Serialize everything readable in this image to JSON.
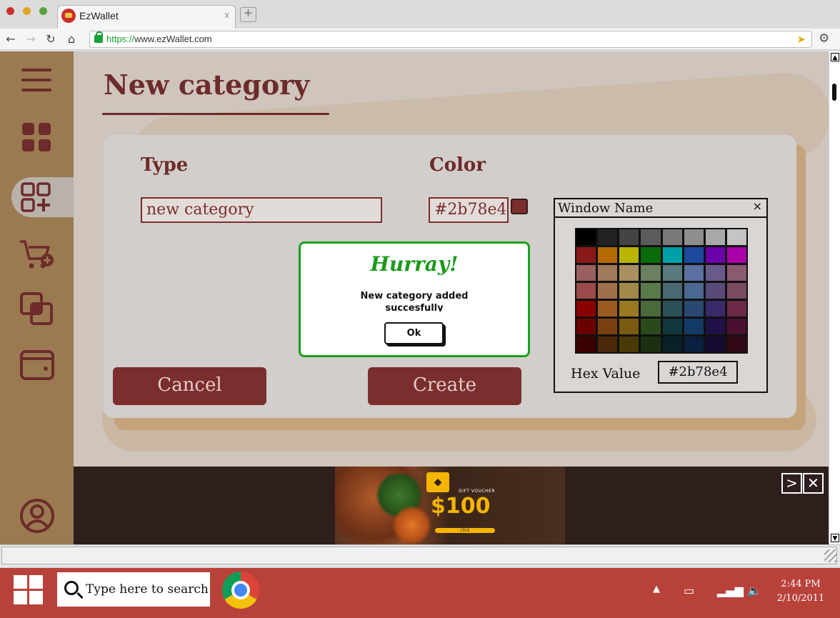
{
  "browser": {
    "tab_title": "EzWallet",
    "tab_close": "x",
    "url_scheme": "https://",
    "url_rest": "www.ezWallet.com"
  },
  "page": {
    "title": "New category",
    "type_label": "Type",
    "type_value": "new category",
    "color_label": "Color",
    "color_value": "#2b78e4",
    "cancel_label": "Cancel",
    "create_label": "Create"
  },
  "color_picker": {
    "window_name": "Window Name",
    "close": "×",
    "hex_label": "Hex Value",
    "hex_value": "#2b78e4",
    "palette": [
      "#000000",
      "#222222",
      "#444444",
      "#5b5b5b",
      "#7a7a7a",
      "#8e8e8e",
      "#a8a8a8",
      "#c4c4c4",
      "#8a1a1a",
      "#b46a00",
      "#b8b400",
      "#0a6b0a",
      "#00a0a8",
      "#1d4a9e",
      "#6b00a8",
      "#a800a8",
      "#9a6060",
      "#a07a5a",
      "#a89060",
      "#6a8060",
      "#5a7a80",
      "#5a70a0",
      "#6a5a8a",
      "#8a5a70",
      "#9a4a4a",
      "#a0704a",
      "#a08a4a",
      "#5a7a4a",
      "#4a6870",
      "#4a6890",
      "#5a4a7a",
      "#7a4a60",
      "#8a0000",
      "#9a5a20",
      "#9a7a20",
      "#4a6a3a",
      "#2a5058",
      "#2a4870",
      "#3a2a6a",
      "#6a2a48",
      "#6a0000",
      "#7a4010",
      "#7a5a10",
      "#2a4a1a",
      "#10363e",
      "#123a64",
      "#221048",
      "#4a1030",
      "#3a0000",
      "#4a2808",
      "#4a3a08",
      "#1a3010",
      "#0a2028",
      "#0a2040",
      "#160a30",
      "#300818"
    ]
  },
  "dialog": {
    "title": "Hurray!",
    "message": "New category added succesfully",
    "ok_label": "Ok"
  },
  "ad": {
    "voucher_text": "GIFT VOUCHER",
    "price": "$100",
    "click_text": "click",
    "next": ">",
    "close": "✕"
  },
  "taskbar": {
    "search_placeholder": "Type here to search",
    "time": "2:44 PM",
    "date": "2/10/2011"
  }
}
